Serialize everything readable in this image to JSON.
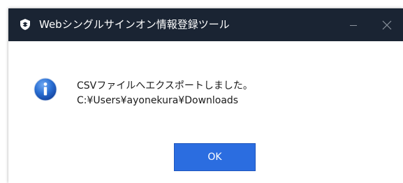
{
  "window": {
    "title": "Webシングルサインオン情報登録ツール",
    "app_icon": "app-shield-icon",
    "controls": {
      "minimize_icon": "minimize-icon",
      "close_icon": "close-icon"
    }
  },
  "dialog": {
    "icon": "info-icon",
    "message_line1": "CSVファイルへエクスポートしました。",
    "message_line2": "C:¥Users¥ayonekura¥Downloads",
    "ok_label": "OK"
  },
  "colors": {
    "titlebar": "#1a2433",
    "ok_button": "#2b6de0",
    "info_icon": "#1f63c6"
  }
}
